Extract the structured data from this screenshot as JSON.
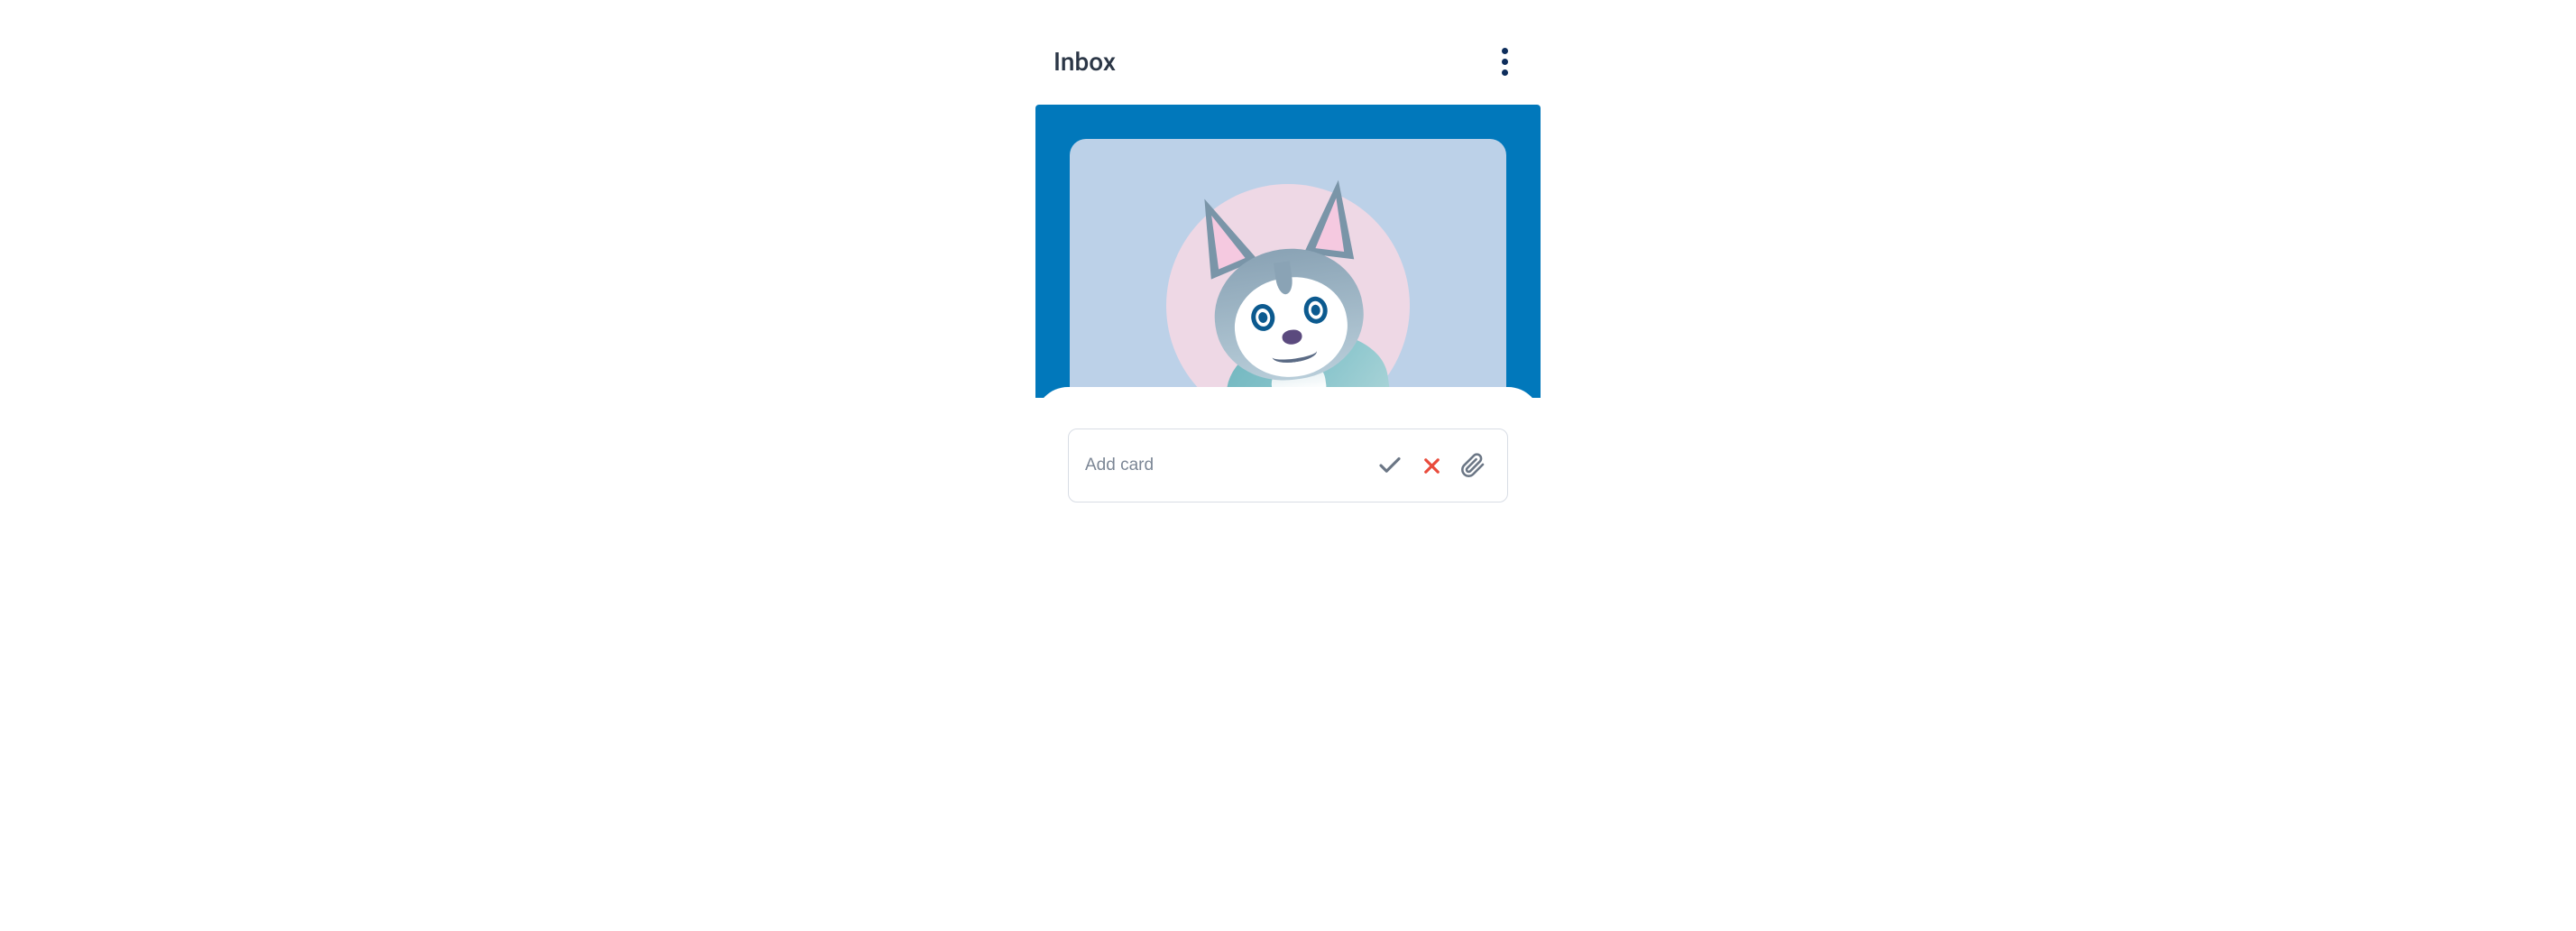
{
  "column": {
    "title": "Inbox"
  },
  "input": {
    "placeholder": "Add card"
  },
  "icons": {
    "more": "more-vertical",
    "confirm": "check",
    "cancel": "close",
    "attach": "paperclip"
  },
  "colors": {
    "columnBg": "#0178bb",
    "cardBg": "#bcd1e8",
    "circleBg": "#eed8e5",
    "titleText": "#2b3646",
    "placeholderText": "#7b8695",
    "checkIcon": "#6b7685",
    "closeIcon": "#e94b3c",
    "clipIcon": "#6b7685"
  }
}
